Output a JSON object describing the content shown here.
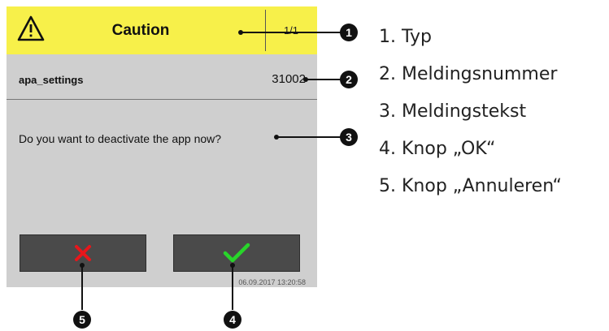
{
  "dialog": {
    "title": "Caution",
    "page_indicator": "1/1",
    "app_name": "apa_settings",
    "message_number": "31002",
    "message": "Do you want to deactivate the app now?",
    "timestamp": "06.09.2017 13:20:58",
    "icons": {
      "type": "warning-triangle-icon",
      "cancel": "cross-icon",
      "ok": "checkmark-icon"
    },
    "colors": {
      "title_bar": "#f7f04a",
      "background": "#cfcfcf",
      "button": "#4a4a4a",
      "cancel_icon": "#e8161b",
      "ok_icon": "#28d52a"
    }
  },
  "callouts": {
    "numbers": [
      "1",
      "2",
      "3",
      "4",
      "5"
    ]
  },
  "legend": {
    "items": [
      {
        "number": "1.",
        "label": "Typ"
      },
      {
        "number": "2.",
        "label": "Meldingsnummer"
      },
      {
        "number": "3.",
        "label": "Meldingstekst"
      },
      {
        "number": "4.",
        "label": "Knop „OK“"
      },
      {
        "number": "5.",
        "label": "Knop „Annuleren“"
      }
    ]
  }
}
